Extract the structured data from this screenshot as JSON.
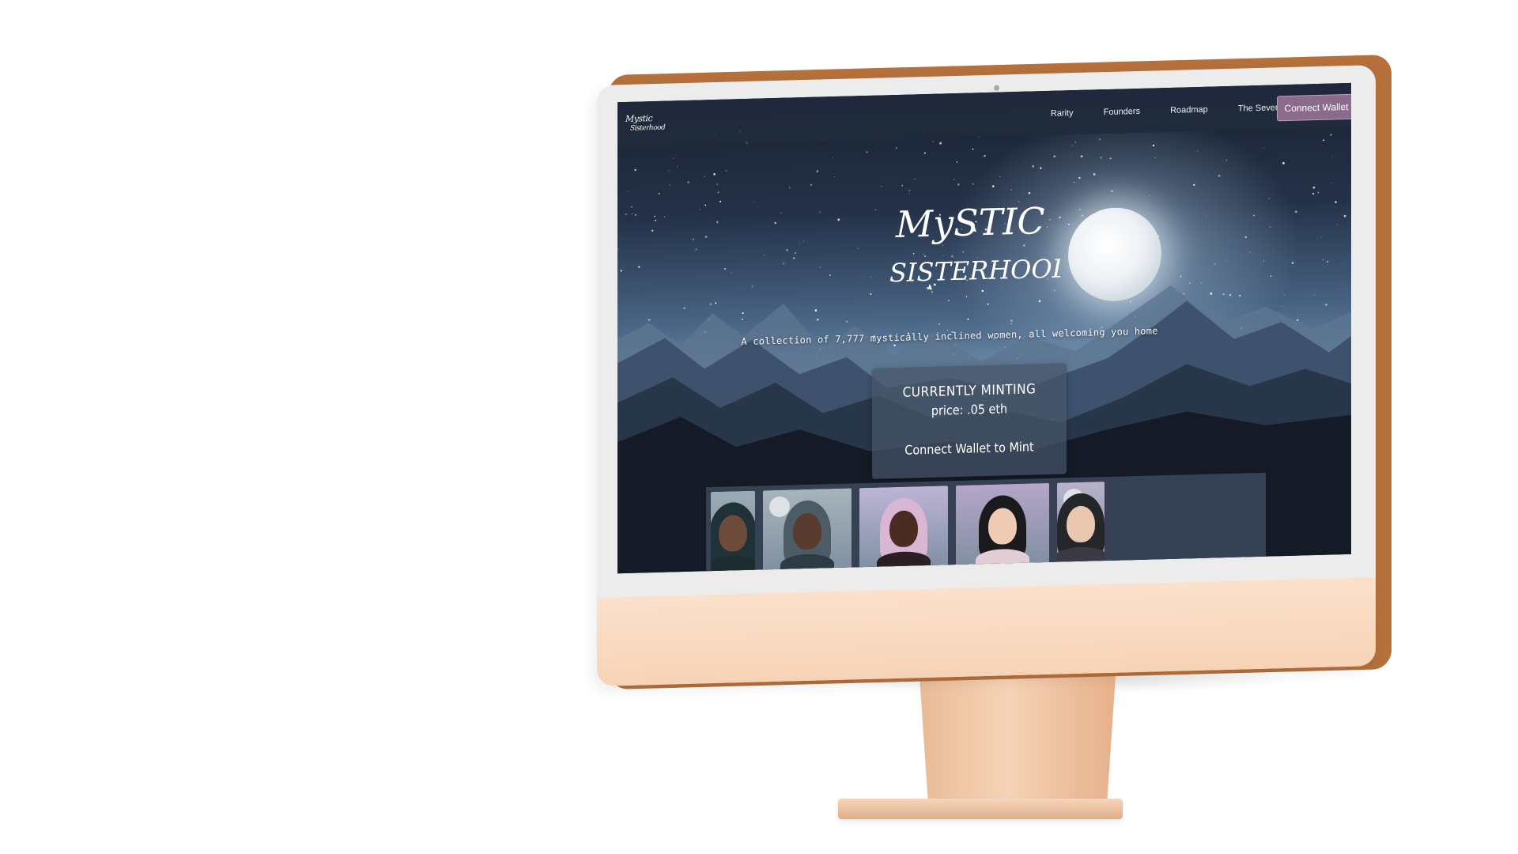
{
  "nav": {
    "logo_line1": "Mystic",
    "logo_line2": "Sisterhood",
    "links": [
      "Rarity",
      "Founders",
      "Roadmap",
      "The Seven"
    ],
    "connect_label": "Connect Wallet"
  },
  "hero": {
    "logo_line1": "MySTIC",
    "logo_line2": "SISTERHOOD",
    "tagline": "A collection of 7,777 mystically inclined women, all welcoming you home"
  },
  "mint": {
    "status": "CURRENTLY MINTING",
    "price": "price: .05 eth",
    "action": "Connect Wallet to Mint"
  },
  "gallery": {
    "portraits": [
      {
        "bg": "#9aaab6",
        "skin": "#6e4a3a",
        "hair": "#1e3238",
        "top": "#1d2a2e",
        "moon": false,
        "width": 56
      },
      {
        "bg": "#a8b4bc",
        "skin": "#5a3b30",
        "hair": "#4c5c66",
        "top": "#2d3b44",
        "moon": true,
        "width": 112
      },
      {
        "bg": "#bdb5d6",
        "skin": "#4a2c22",
        "hair": "#d8b6d4",
        "top": "#2a2024",
        "moon": false,
        "width": 112
      },
      {
        "bg": "#b5a6c8",
        "skin": "#f0cbb4",
        "hair": "#1a1a1c",
        "top": "#e2ccd6",
        "moon": false,
        "width": 118
      },
      {
        "bg": "#b9b2cc",
        "skin": "#e8c6b0",
        "hair": "#25262a",
        "top": "#3b3a44",
        "moon": true,
        "width": 60
      }
    ]
  },
  "colors": {
    "accent_button": "#8a6b8c",
    "device_chin": "#f7d3b6",
    "device_edge": "#b5703c"
  }
}
